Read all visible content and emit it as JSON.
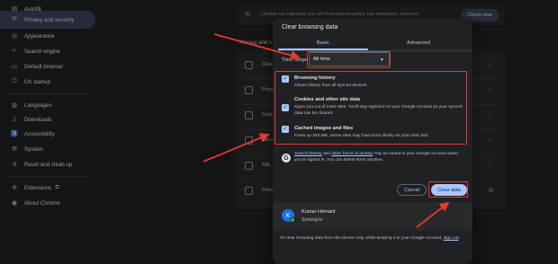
{
  "sidebar": {
    "items": [
      {
        "label": "Autofill",
        "icon": "autofill-icon"
      },
      {
        "label": "Privacy and security",
        "icon": "shield-icon",
        "active": true
      },
      {
        "label": "Appearance",
        "icon": "palette-icon"
      },
      {
        "label": "Search engine",
        "icon": "search-icon"
      },
      {
        "label": "Default browser",
        "icon": "browser-icon"
      },
      {
        "label": "On startup",
        "icon": "power-icon"
      },
      {
        "label": "Languages",
        "icon": "globe-icon"
      },
      {
        "label": "Downloads",
        "icon": "download-icon"
      },
      {
        "label": "Accessibility",
        "icon": "accessibility-icon"
      },
      {
        "label": "System",
        "icon": "wrench-icon"
      },
      {
        "label": "Reset and clean up",
        "icon": "reset-icon"
      },
      {
        "label": "Extensions",
        "icon": "puzzle-icon"
      },
      {
        "label": "About Chrome",
        "icon": "chrome-icon"
      }
    ]
  },
  "background": {
    "banner_text": "Chrome can help keep you safe from data breaches, bad extensions, and more",
    "check_now": "Check now",
    "section_title": "Privacy and s",
    "rows": [
      "Clea",
      "Priva",
      "Cook",
      "Secu",
      "Site",
      "Priva"
    ]
  },
  "dialog": {
    "title": "Clear browsing data",
    "tabs": {
      "basic": "Basic",
      "advanced": "Advanced"
    },
    "time_range_label": "Time range",
    "time_range_value": "All time",
    "options": [
      {
        "title": "Browsing history",
        "desc": "Clears history from all synced devices",
        "checked": true
      },
      {
        "title": "Cookies and other site data",
        "desc": "Signs you out of most sites. You'll stay signed in to your Google Account so your synced data can be cleared.",
        "checked": true
      },
      {
        "title": "Cached images and files",
        "desc": "Frees up 320 MB. Some sites may load more slowly on your next visit.",
        "checked": true
      }
    ],
    "google_note": {
      "link1": "Search history",
      "mid": " and ",
      "link2": "other forms of activity",
      "rest": " may be saved in your Google Account when you're signed in. You can delete them anytime."
    },
    "cancel": "Cancel",
    "clear": "Clear data",
    "account": {
      "initial": "K",
      "name": "Kumar Hemant",
      "status": "Syncing to"
    },
    "footer": {
      "text": "To clear browsing data from this device only, while keeping it in your Google Account, ",
      "link": "sign out",
      "end": "."
    }
  },
  "colors": {
    "accent": "#a8c7fa",
    "highlight": "#e53935",
    "background": "#1f1f1f"
  }
}
